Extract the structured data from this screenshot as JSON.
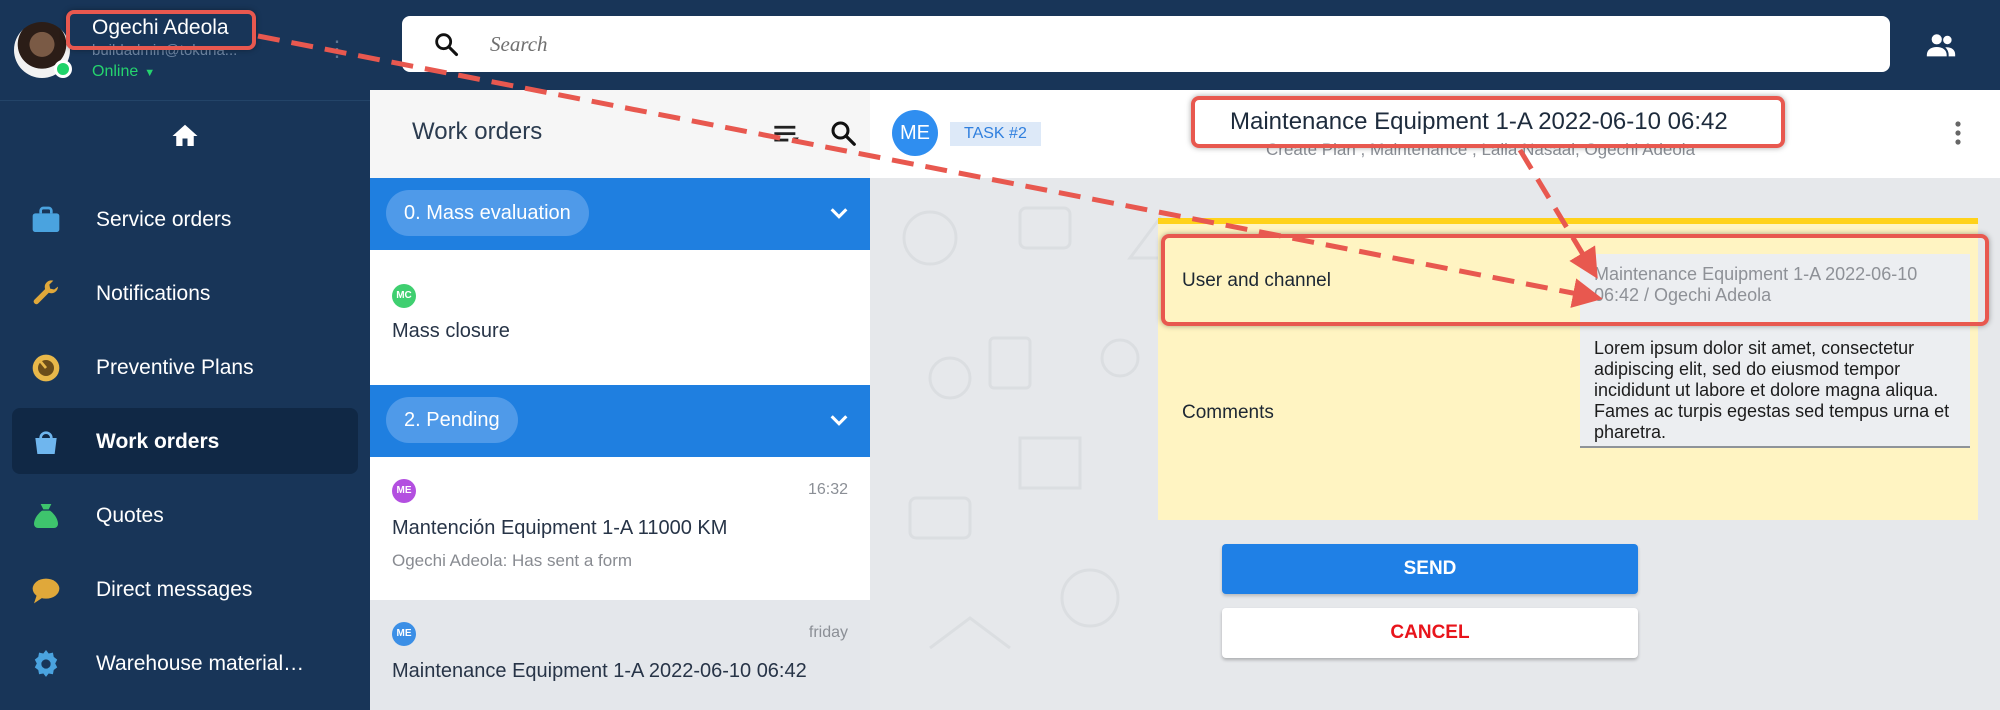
{
  "user": {
    "name": "Ogechi Adeola",
    "email": "buildadmin@tokuna...",
    "status": "Online"
  },
  "search": {
    "placeholder": "Search"
  },
  "sidebar": {
    "items": [
      {
        "label": "Service orders",
        "icon": "briefcase-icon",
        "color": "#4aa3df"
      },
      {
        "label": "Notifications",
        "icon": "wrench-icon",
        "color": "#e0a83a"
      },
      {
        "label": "Preventive Plans",
        "icon": "gauge-icon",
        "color": "#e8b84a"
      },
      {
        "label": "Work orders",
        "icon": "bag-icon",
        "color": "#6fb6ee",
        "active": true
      },
      {
        "label": "Quotes",
        "icon": "money-bag-icon",
        "color": "#3ec46d"
      },
      {
        "label": "Direct messages",
        "icon": "chat-bubble-icon",
        "color": "#e0a83a"
      },
      {
        "label": "Warehouse material…",
        "icon": "gear-icon",
        "color": "#4aa3df"
      }
    ]
  },
  "work_orders": {
    "title": "Work orders",
    "groups": [
      {
        "label": "0. Mass evaluation"
      },
      {
        "label": "2. Pending"
      }
    ],
    "items": [
      {
        "initials": "MC",
        "avatar_color": "#3fcf70",
        "title": "Mass closure",
        "time": "",
        "subtitle": ""
      },
      {
        "initials": "ME",
        "avatar_color": "#b34fe0",
        "title": "Mantención Equipment 1-A 11000 KM",
        "time": "16:32",
        "subtitle": "Ogechi Adeola: Has sent a form"
      },
      {
        "initials": "ME",
        "avatar_color": "#3b8fe6",
        "title": "Maintenance Equipment 1-A 2022-06-10 06:42",
        "time": "friday",
        "subtitle": ""
      }
    ]
  },
  "detail": {
    "avatar_initials": "ME",
    "task_badge": "TASK #2",
    "title": "Maintenance Equipment 1-A 2022-06-10 06:42",
    "subtitle": "Create Plan , Maintenance , Laila Nasaal, Ogechi Adeola",
    "form": {
      "user_channel_label": "User and channel",
      "user_channel_value": "Maintenance Equipment 1-A 2022-06-10 06:42 / Ogechi Adeola",
      "comments_label": "Comments",
      "comments_value": "Lorem ipsum dolor sit amet, consectetur adipiscing elit, sed do eiusmod tempor incididunt ut labore et dolore magna aliqua. Fames ac turpis egestas sed tempus urna et pharetra."
    },
    "send_label": "SEND",
    "cancel_label": "CANCEL"
  },
  "colors": {
    "sidebar_bg": "#183558",
    "accent_blue": "#1f80e6",
    "annotation_red": "#e8584f",
    "form_bg": "#fff4c2",
    "cancel_red": "#e8141b"
  }
}
